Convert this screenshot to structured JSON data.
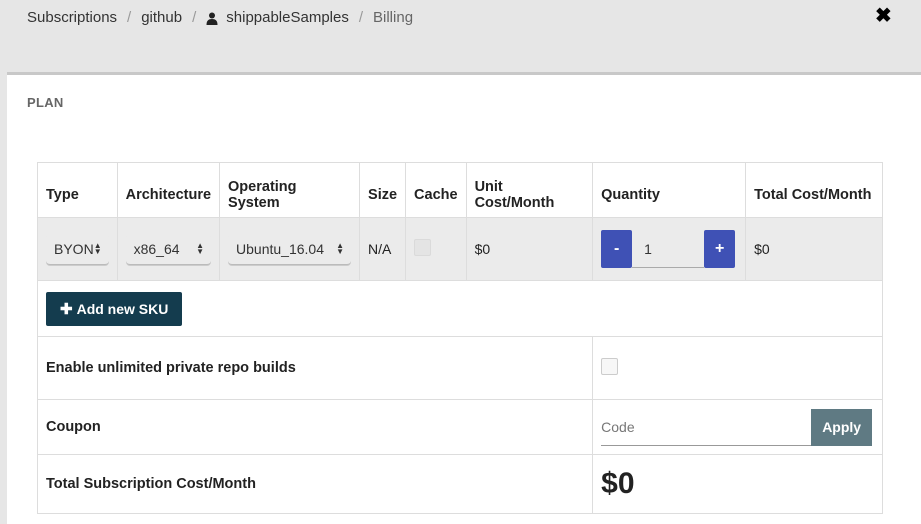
{
  "breadcrumb": {
    "items": [
      "Subscriptions",
      "github",
      "shippableSamples"
    ],
    "current": "Billing"
  },
  "panel": {
    "title": "PLAN"
  },
  "table": {
    "headers": [
      "Type",
      "Architecture",
      "Operating System",
      "Size",
      "Cache",
      "Unit Cost/Month",
      "Quantity",
      "Total Cost/Month"
    ],
    "sku": {
      "type": "BYON",
      "architecture": "x86_64",
      "os": "Ubuntu_16.04",
      "size": "N/A",
      "unit_cost": "$0",
      "quantity": "1",
      "total_cost": "$0",
      "minus": "-",
      "plus": "+"
    },
    "add_sku_label": "Add new SKU"
  },
  "options": {
    "unlimited_label": "Enable unlimited private repo builds",
    "coupon_label": "Coupon",
    "coupon_placeholder": "Code",
    "apply_label": "Apply",
    "total_label": "Total Subscription Cost/Month",
    "total_value": "$0"
  },
  "colors": {
    "accent": "#3f51b5",
    "primary_dark": "#143c4e",
    "apply": "#5f7a83"
  }
}
